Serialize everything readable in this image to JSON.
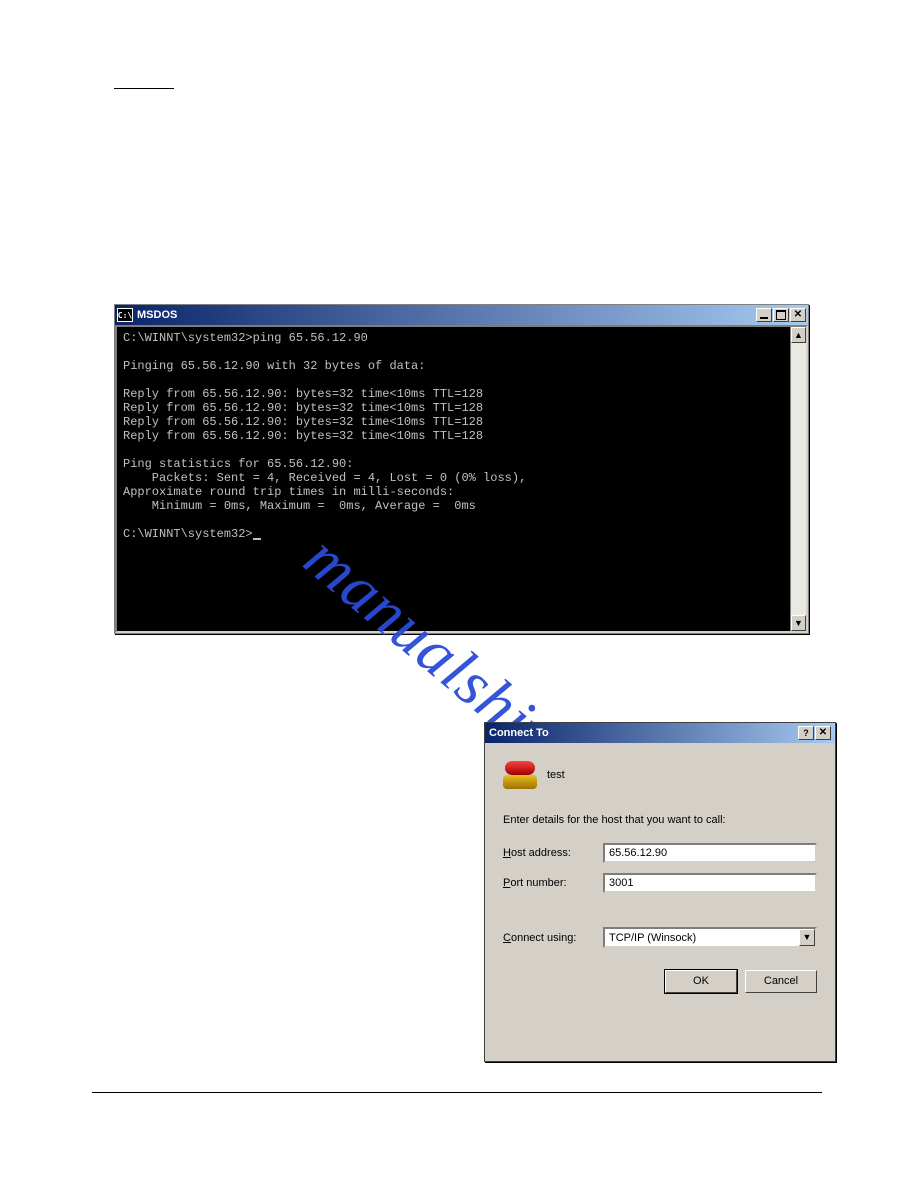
{
  "msdos": {
    "title": "MSDOS",
    "icon_text": "C:\\",
    "lines": [
      "C:\\WINNT\\system32>ping 65.56.12.90",
      "",
      "Pinging 65.56.12.90 with 32 bytes of data:",
      "",
      "Reply from 65.56.12.90: bytes=32 time<10ms TTL=128",
      "Reply from 65.56.12.90: bytes=32 time<10ms TTL=128",
      "Reply from 65.56.12.90: bytes=32 time<10ms TTL=128",
      "Reply from 65.56.12.90: bytes=32 time<10ms TTL=128",
      "",
      "Ping statistics for 65.56.12.90:",
      "    Packets: Sent = 4, Received = 4, Lost = 0 (0% loss),",
      "Approximate round trip times in milli-seconds:",
      "    Minimum = 0ms, Maximum =  0ms, Average =  0ms",
      "",
      "C:\\WINNT\\system32>"
    ]
  },
  "watermark_text": "manualshive.com",
  "connect": {
    "title": "Connect To",
    "name": "test",
    "prompt": "Enter details for the host that you want to call:",
    "host_label_prefix": "H",
    "host_label_rest": "ost address:",
    "host_value": "65.56.12.90",
    "port_label_prefix": "P",
    "port_label_rest": "ort number:",
    "port_value": "3001",
    "connect_label_prefix": "C",
    "connect_label_rest": "onnect using:",
    "connect_value": "TCP/IP (Winsock)",
    "ok_label": "OK",
    "cancel_label": "Cancel",
    "help_glyph": "?",
    "close_glyph": "✕"
  },
  "scroll": {
    "up": "▲",
    "down": "▼"
  }
}
